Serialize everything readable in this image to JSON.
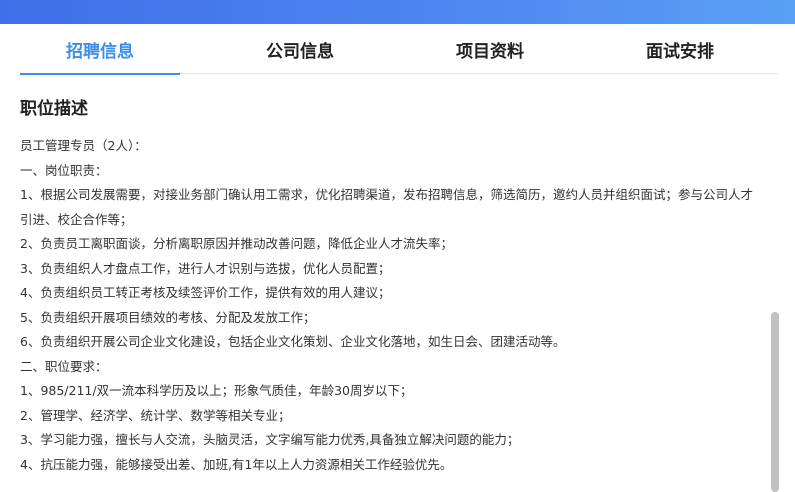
{
  "tabs": [
    {
      "label": "招聘信息",
      "active": true
    },
    {
      "label": "公司信息",
      "active": false
    },
    {
      "label": "项目资料",
      "active": false
    },
    {
      "label": "面试安排",
      "active": false
    }
  ],
  "section_title": "职位描述",
  "description_lines": [
    "员工管理专员（2人）：",
    "一、岗位职责：",
    "1、根据公司发展需要，对接业务部门确认用工需求，优化招聘渠道，发布招聘信息，筛选简历，邀约人员并组织面试；参与公司人才引进、校企合作等；",
    "2、负责员工离职面谈，分析离职原因并推动改善问题，降低企业人才流失率；",
    "3、负责组织人才盘点工作，进行人才识别与选拔，优化人员配置；",
    "4、负责组织员工转正考核及续签评价工作，提供有效的用人建议；",
    "5、负责组织开展项目绩效的考核、分配及发放工作；",
    "6、负责组织开展公司企业文化建设，包括企业文化策划、企业文化落地，如生日会、团建活动等。",
    "二、职位要求：",
    "1、985/211/双一流本科学历及以上；形象气质佳，年龄30周岁以下；",
    "2、管理学、经济学、统计学、数学等相关专业；",
    "3、学习能力强，擅长与人交流，头脑灵活，文字编写能力优秀,具备独立解决问题的能力；",
    "4、抗压能力强，能够接受出差、加班,有1年以上人力资源相关工作经验优先。"
  ],
  "colors": {
    "accent": "#3d8ee8",
    "banner": "#4d86f0",
    "text": "#333333"
  }
}
